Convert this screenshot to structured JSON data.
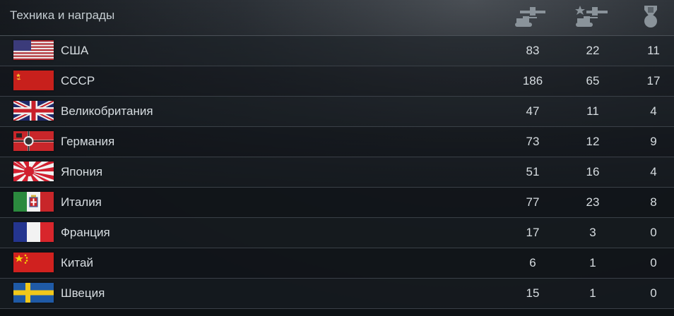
{
  "header": {
    "title": "Техника и награды",
    "columns": [
      {
        "icon": "vehicles-icon"
      },
      {
        "icon": "premium-vehicles-icon"
      },
      {
        "icon": "medal-icon"
      }
    ]
  },
  "rows": [
    {
      "country": "США",
      "flag": "usa-flag-icon",
      "vehicles": "83",
      "premium": "22",
      "medals": "11"
    },
    {
      "country": "СССР",
      "flag": "ussr-flag-icon",
      "vehicles": "186",
      "premium": "65",
      "medals": "17"
    },
    {
      "country": "Великобритания",
      "flag": "uk-flag-icon",
      "vehicles": "47",
      "premium": "11",
      "medals": "4"
    },
    {
      "country": "Германия",
      "flag": "germany-flag-icon",
      "vehicles": "73",
      "premium": "12",
      "medals": "9"
    },
    {
      "country": "Япония",
      "flag": "japan-flag-icon",
      "vehicles": "51",
      "premium": "16",
      "medals": "4"
    },
    {
      "country": "Италия",
      "flag": "italy-flag-icon",
      "vehicles": "77",
      "premium": "23",
      "medals": "8"
    },
    {
      "country": "Франция",
      "flag": "france-flag-icon",
      "vehicles": "17",
      "premium": "3",
      "medals": "0"
    },
    {
      "country": "Китай",
      "flag": "china-flag-icon",
      "vehicles": "6",
      "premium": "1",
      "medals": "0"
    },
    {
      "country": "Швеция",
      "flag": "sweden-flag-icon",
      "vehicles": "15",
      "premium": "1",
      "medals": "0"
    }
  ]
}
